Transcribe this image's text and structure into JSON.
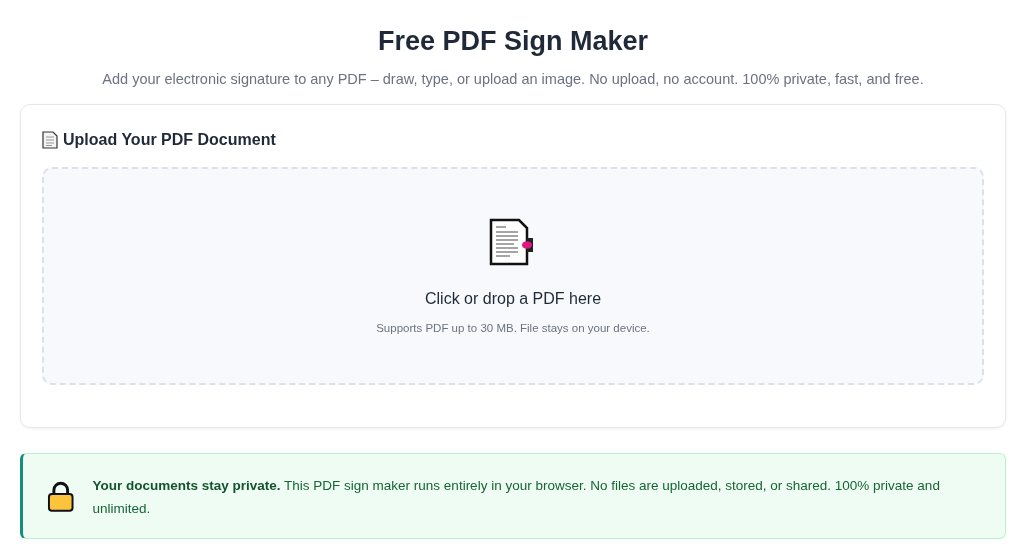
{
  "header": {
    "title": "Free PDF Sign Maker",
    "subtitle": "Add your electronic signature to any PDF – draw, type, or upload an image. No upload, no account. 100% private, fast, and free."
  },
  "upload_card": {
    "heading": "Upload Your PDF Document",
    "dropzone": {
      "prompt": "Click or drop a PDF here",
      "hint": "Supports PDF up to 30 MB. File stays on your device."
    }
  },
  "privacy_notice": {
    "text": "**Your documents stay private.** This PDF sign maker runs entirely in your browser. No files are uploaded, stored, or shared. 100% private and unlimited."
  }
}
